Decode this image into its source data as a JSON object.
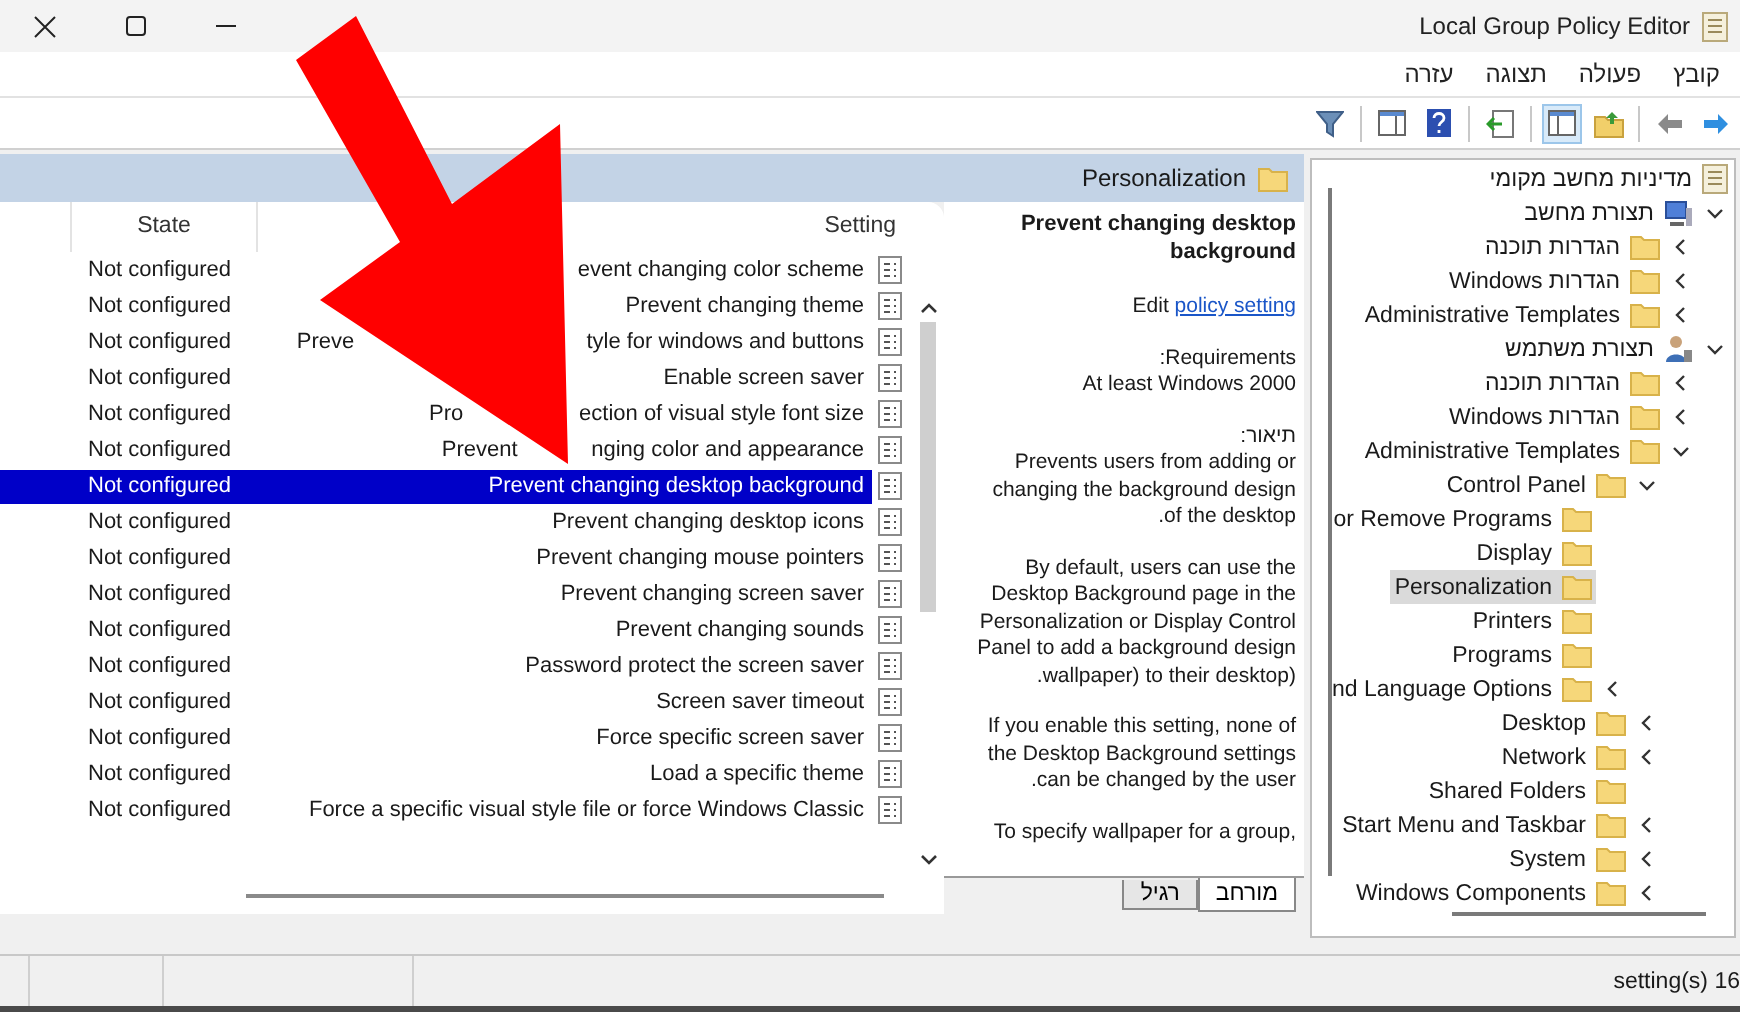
{
  "window": {
    "title": "Local Group Policy Editor"
  },
  "menu": [
    "קובץ",
    "פעולה",
    "תצוגה",
    "עזרה"
  ],
  "header": {
    "title": "Personalization"
  },
  "list": {
    "columns": [
      "State",
      "Setting"
    ],
    "rows": [
      {
        "state": "Not configured",
        "setting": [
          "event changing color scheme"
        ],
        "selected": false
      },
      {
        "state": "Not configured",
        "setting": [
          "Prevent changing theme"
        ],
        "selected": false
      },
      {
        "state": "Not configured",
        "setting": [
          "Preve",
          "tyle for windows and buttons"
        ],
        "selected": false
      },
      {
        "state": "Not configured",
        "setting": [
          "Enable screen saver"
        ],
        "selected": false
      },
      {
        "state": "Not configured",
        "setting": [
          "Pro",
          "ection of visual style font size"
        ],
        "selected": false
      },
      {
        "state": "Not configured",
        "setting": [
          "Prevent",
          "nging color and appearance"
        ],
        "selected": false
      },
      {
        "state": "Not configured",
        "setting": [
          "Prevent changing desktop background"
        ],
        "selected": true
      },
      {
        "state": "Not configured",
        "setting": [
          "Prevent changing desktop icons"
        ],
        "selected": false
      },
      {
        "state": "Not configured",
        "setting": [
          "Prevent changing mouse pointers"
        ],
        "selected": false
      },
      {
        "state": "Not configured",
        "setting": [
          "Prevent changing screen saver"
        ],
        "selected": false
      },
      {
        "state": "Not configured",
        "setting": [
          "Prevent changing sounds"
        ],
        "selected": false
      },
      {
        "state": "Not configured",
        "setting": [
          "Password protect the screen saver"
        ],
        "selected": false
      },
      {
        "state": "Not configured",
        "setting": [
          "Screen saver timeout"
        ],
        "selected": false
      },
      {
        "state": "Not configured",
        "setting": [
          "Force specific screen saver"
        ],
        "selected": false
      },
      {
        "state": "Not configured",
        "setting": [
          "Load a specific theme"
        ],
        "selected": false
      },
      {
        "state": "Not configured",
        "setting": [
          "Force a specific visual style file or force Windows Classic"
        ],
        "selected": false
      }
    ]
  },
  "description": {
    "title": "Prevent changing desktop background",
    "edit_label": "Edit",
    "edit_link": "policy setting",
    "requirements_label": ":Requirements",
    "requirements_value": "At least Windows 2000",
    "description_label": "תיאור:",
    "paragraphs": [
      "Prevents users from adding or changing the background design .of the desktop",
      "By default, users can use the Desktop Background page in the Personalization or Display Control Panel to add a background design .wallpaper) to their desktop)",
      "If you enable this setting, none of the Desktop Background settings .can be changed by the user",
      "To specify wallpaper for a group,"
    ]
  },
  "tabs": [
    {
      "label": "מורחב",
      "selected": true
    },
    {
      "label": "רגיל",
      "selected": false
    }
  ],
  "tree": [
    {
      "label": "מדיניות מחשב מקומי",
      "kind": "policy",
      "selected": false,
      "children": [
        {
          "label": "תצורת מחשב",
          "kind": "computer",
          "expanded": true,
          "selected": false,
          "children": [
            {
              "label": "הגדרות תוכנה",
              "kind": "folder",
              "expanded": false,
              "selected": false
            },
            {
              "label": "הגדרות Windows",
              "kind": "folder",
              "expanded": false,
              "selected": false
            },
            {
              "label": "Administrative Templates",
              "kind": "folder",
              "expanded": false,
              "selected": false
            }
          ]
        },
        {
          "label": "תצורת משתמש",
          "kind": "user",
          "expanded": true,
          "selected": false,
          "children": [
            {
              "label": "הגדרות תוכנה",
              "kind": "folder",
              "expanded": false,
              "selected": false
            },
            {
              "label": "הגדרות Windows",
              "kind": "folder",
              "expanded": false,
              "selected": false
            },
            {
              "label": "Administrative Templates",
              "kind": "folder",
              "expanded": true,
              "selected": false,
              "children": [
                {
                  "label": "Control Panel",
                  "kind": "folder",
                  "expanded": true,
                  "selected": false,
                  "children": [
                    {
                      "label": "or Remove Programs",
                      "kind": "folder",
                      "selected": false
                    },
                    {
                      "label": "Display",
                      "kind": "folder",
                      "selected": false
                    },
                    {
                      "label": "Personalization",
                      "kind": "folder",
                      "selected": true
                    },
                    {
                      "label": "Printers",
                      "kind": "folder",
                      "selected": false
                    },
                    {
                      "label": "Programs",
                      "kind": "folder",
                      "selected": false
                    },
                    {
                      "label": "nd Language Options",
                      "kind": "folder",
                      "expanded": false,
                      "selected": false
                    }
                  ]
                },
                {
                  "label": "Desktop",
                  "kind": "folder",
                  "expanded": false,
                  "selected": false
                },
                {
                  "label": "Network",
                  "kind": "folder",
                  "expanded": false,
                  "selected": false
                },
                {
                  "label": "Shared Folders",
                  "kind": "folder",
                  "selected": false
                },
                {
                  "label": "Start Menu and Taskbar",
                  "kind": "folder",
                  "expanded": false,
                  "selected": false
                },
                {
                  "label": "System",
                  "kind": "folder",
                  "expanded": false,
                  "selected": false
                },
                {
                  "label": "Windows Components",
                  "kind": "folder",
                  "expanded": false,
                  "selected": false
                }
              ]
            }
          ]
        }
      ]
    }
  ],
  "status_bar": {
    "text": "setting(s) 16"
  }
}
